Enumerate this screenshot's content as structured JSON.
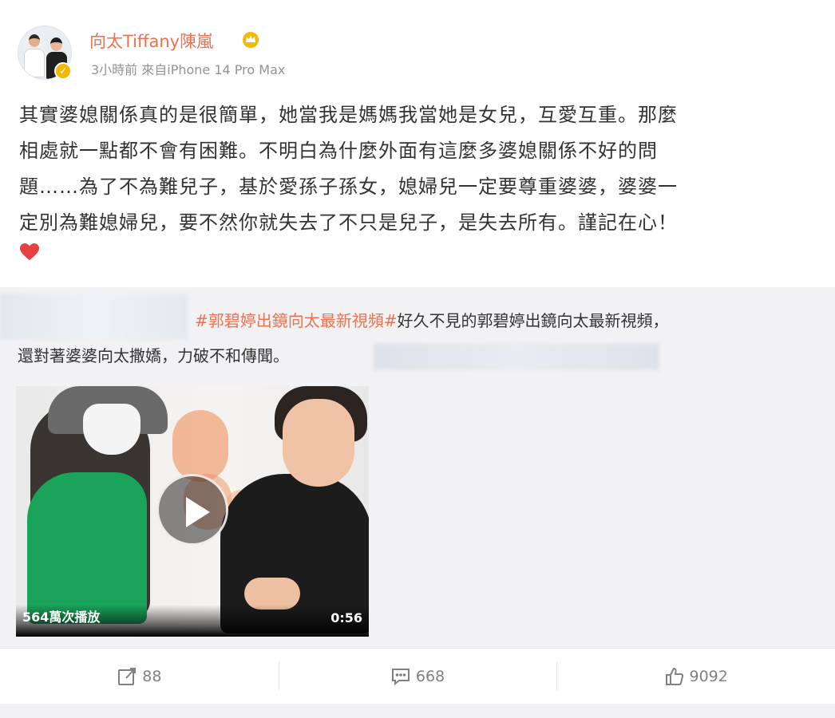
{
  "post": {
    "author_name": "向太Tiffany陳嵐",
    "meta": "3小時前 來自iPhone 14 Pro Max",
    "text_lines": [
      "其實婆媳關係真的是很簡單，她當我是媽媽我當她是女兒，互愛互重。那麼",
      "相處就一點都不會有困難。不明白為什麼外面有這麼多婆媳關係不好的問",
      "題……為了不為難兒子，基於愛孫子孫女，媳婦兒一定要尊重婆婆，婆婆一",
      "定別為難媳婦兒，要不然你就失去了不只是兒子，是失去所有。謹記在心！"
    ]
  },
  "repost": {
    "hashtag": "#郭碧婷出鏡向太最新視頻#",
    "text_line1_rest": "好久不見的郭碧婷出鏡向太最新視頻，",
    "text_line2": "還對著婆婆向太撒嬌，力破不和傳聞。",
    "video": {
      "play_count": "564萬次播放",
      "duration": "0:56"
    }
  },
  "actions": {
    "repost_count": "88",
    "comment_count": "668",
    "like_count": "9092"
  },
  "colors": {
    "accent": "#eb7350",
    "heart": "#e64141",
    "muted": "#939393"
  }
}
